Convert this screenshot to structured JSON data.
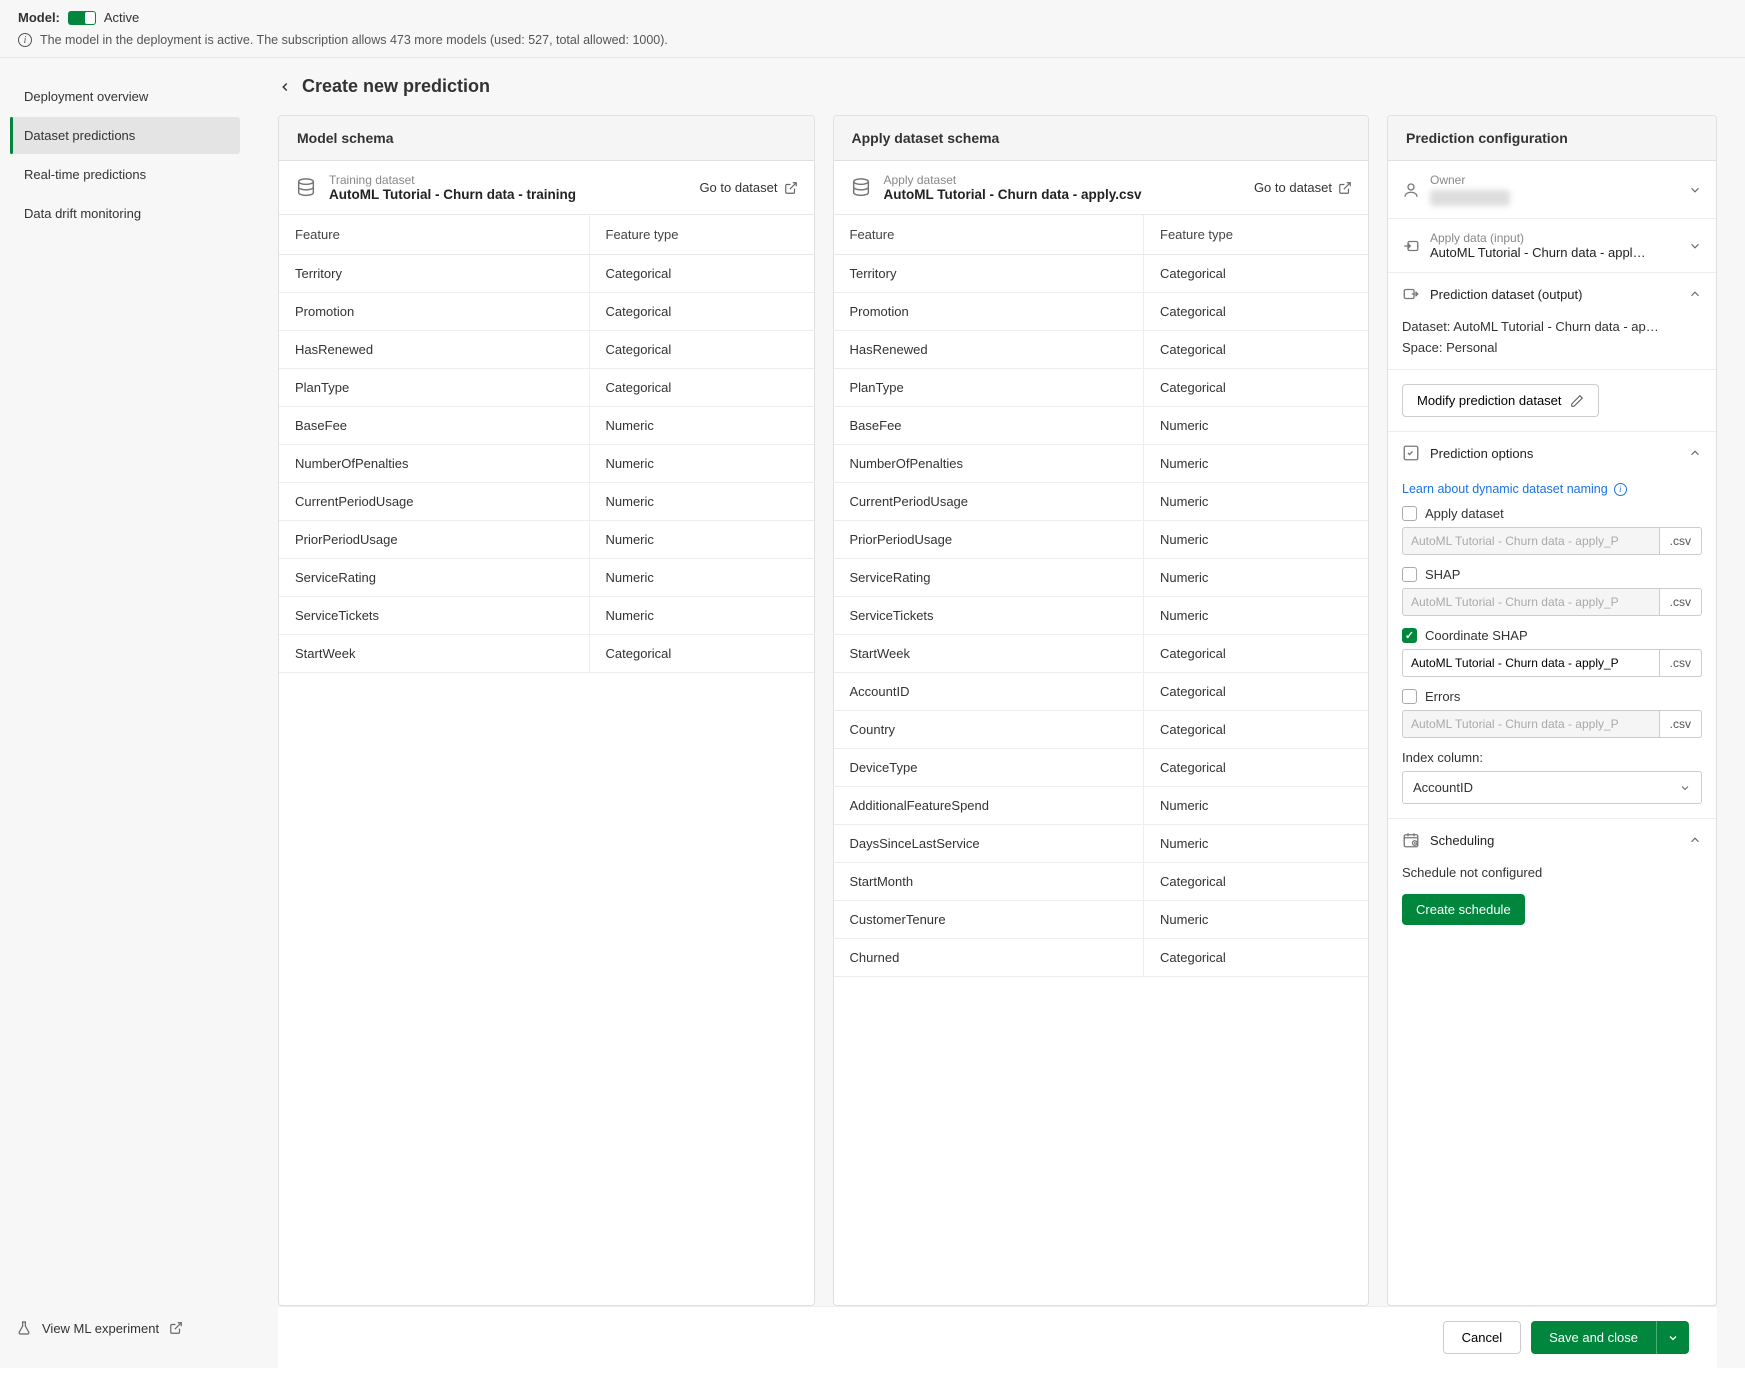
{
  "topbar": {
    "model_label": "Model:",
    "active_label": "Active",
    "info_text": "The model in the deployment is active. The subscription allows 473 more models (used: 527, total allowed: 1000)."
  },
  "sidebar": {
    "items": [
      {
        "label": "Deployment overview"
      },
      {
        "label": "Dataset predictions"
      },
      {
        "label": "Real-time predictions"
      },
      {
        "label": "Data drift monitoring"
      }
    ],
    "footer_link": "View ML experiment"
  },
  "page": {
    "title": "Create new prediction"
  },
  "model_schema": {
    "title": "Model schema",
    "dataset_label": "Training dataset",
    "dataset_name": "AutoML Tutorial - Churn data - training",
    "goto_label": "Go to dataset",
    "col_feature": "Feature",
    "col_type": "Feature type",
    "rows": [
      {
        "feature": "Territory",
        "type": "Categorical"
      },
      {
        "feature": "Promotion",
        "type": "Categorical"
      },
      {
        "feature": "HasRenewed",
        "type": "Categorical"
      },
      {
        "feature": "PlanType",
        "type": "Categorical"
      },
      {
        "feature": "BaseFee",
        "type": "Numeric"
      },
      {
        "feature": "NumberOfPenalties",
        "type": "Numeric"
      },
      {
        "feature": "CurrentPeriodUsage",
        "type": "Numeric"
      },
      {
        "feature": "PriorPeriodUsage",
        "type": "Numeric"
      },
      {
        "feature": "ServiceRating",
        "type": "Numeric"
      },
      {
        "feature": "ServiceTickets",
        "type": "Numeric"
      },
      {
        "feature": "StartWeek",
        "type": "Categorical"
      }
    ]
  },
  "apply_schema": {
    "title": "Apply dataset schema",
    "dataset_label": "Apply dataset",
    "dataset_name": "AutoML Tutorial - Churn data - apply.csv",
    "goto_label": "Go to dataset",
    "col_feature": "Feature",
    "col_type": "Feature type",
    "rows": [
      {
        "feature": "Territory",
        "type": "Categorical"
      },
      {
        "feature": "Promotion",
        "type": "Categorical"
      },
      {
        "feature": "HasRenewed",
        "type": "Categorical"
      },
      {
        "feature": "PlanType",
        "type": "Categorical"
      },
      {
        "feature": "BaseFee",
        "type": "Numeric"
      },
      {
        "feature": "NumberOfPenalties",
        "type": "Numeric"
      },
      {
        "feature": "CurrentPeriodUsage",
        "type": "Numeric"
      },
      {
        "feature": "PriorPeriodUsage",
        "type": "Numeric"
      },
      {
        "feature": "ServiceRating",
        "type": "Numeric"
      },
      {
        "feature": "ServiceTickets",
        "type": "Numeric"
      },
      {
        "feature": "StartWeek",
        "type": "Categorical"
      },
      {
        "feature": "AccountID",
        "type": "Categorical"
      },
      {
        "feature": "Country",
        "type": "Categorical"
      },
      {
        "feature": "DeviceType",
        "type": "Categorical"
      },
      {
        "feature": "AdditionalFeatureSpend",
        "type": "Numeric"
      },
      {
        "feature": "DaysSinceLastService",
        "type": "Numeric"
      },
      {
        "feature": "StartMonth",
        "type": "Categorical"
      },
      {
        "feature": "CustomerTenure",
        "type": "Numeric"
      },
      {
        "feature": "Churned",
        "type": "Categorical"
      }
    ]
  },
  "config": {
    "title": "Prediction configuration",
    "owner_label": "Owner",
    "apply_data_label": "Apply data (input)",
    "apply_data_value": "AutoML Tutorial - Churn data - appl…",
    "pred_output_label": "Prediction dataset (output)",
    "dataset_line": "Dataset: AutoML Tutorial - Churn data - ap…",
    "space_line": "Space: Personal",
    "modify_btn": "Modify prediction dataset",
    "options_label": "Prediction options",
    "learn_link": "Learn about dynamic dataset naming",
    "opts": {
      "apply": {
        "label": "Apply dataset",
        "value": "AutoML Tutorial - Churn data - apply_P",
        "ext": ".csv"
      },
      "shap": {
        "label": "SHAP",
        "value": "AutoML Tutorial - Churn data - apply_P",
        "ext": ".csv"
      },
      "coord": {
        "label": "Coordinate SHAP",
        "value": "AutoML Tutorial - Churn data - apply_P",
        "ext": ".csv"
      },
      "errors": {
        "label": "Errors",
        "value": "AutoML Tutorial - Churn data - apply_P",
        "ext": ".csv"
      }
    },
    "index_label": "Index column:",
    "index_value": "AccountID",
    "scheduling_label": "Scheduling",
    "sched_status": "Schedule not configured",
    "create_sched_btn": "Create schedule"
  },
  "footer": {
    "cancel": "Cancel",
    "save": "Save and close"
  }
}
